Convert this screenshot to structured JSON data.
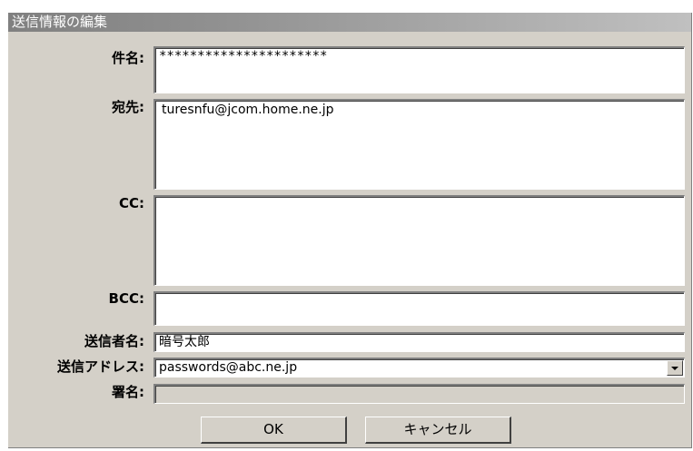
{
  "dialog": {
    "title": "送信情報の編集"
  },
  "fields": {
    "subject": {
      "label": "件名:",
      "value": "**********************"
    },
    "to": {
      "label": "宛先:",
      "value": "turesnfu@jcom.home.ne.jp"
    },
    "cc": {
      "label": "CC:",
      "value": ""
    },
    "bcc": {
      "label": "BCC:",
      "value": ""
    },
    "sender_name": {
      "label": "送信者名:",
      "value": "暗号太郎"
    },
    "sender_address": {
      "label": "送信アドレス:",
      "value": "passwords@abc.ne.jp"
    },
    "signature": {
      "label": "署名:",
      "value": ""
    }
  },
  "buttons": {
    "ok": "OK",
    "cancel": "キャンセル"
  }
}
